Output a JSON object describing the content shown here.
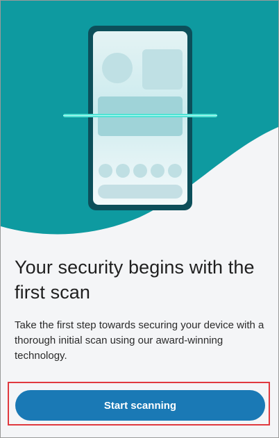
{
  "hero": {
    "illustration": "phone-scan-illustration",
    "colors": {
      "teal_background": "#0e9aa0",
      "phone_frame": "#0c4f5a",
      "scan_line": "#4fe3d4",
      "placeholder_shape": "#bfe3e6"
    }
  },
  "onboarding": {
    "headline": "Your security begins with the first scan",
    "description": "Take the first step towards securing your device with a thorough initial scan using our award-winning technology."
  },
  "actions": {
    "start_scanning_label": "Start scanning",
    "button_color": "#1a79b5",
    "highlight_color": "#e0393e"
  }
}
